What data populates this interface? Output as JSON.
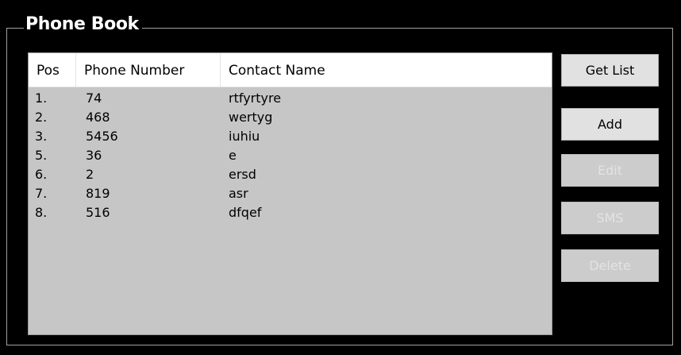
{
  "phonebook": {
    "title": "Phone Book",
    "columns": {
      "pos": "Pos",
      "phone": "Phone Number",
      "name": "Contact Name"
    },
    "rows": [
      {
        "pos": "1.",
        "phone": "74",
        "name": "rtfyrtyre"
      },
      {
        "pos": "2.",
        "phone": "468",
        "name": "wertyg"
      },
      {
        "pos": "3.",
        "phone": "5456",
        "name": "iuhiu"
      },
      {
        "pos": "5.",
        "phone": "36",
        "name": "e"
      },
      {
        "pos": "6.",
        "phone": "2",
        "name": "ersd"
      },
      {
        "pos": "7.",
        "phone": "819",
        "name": "asr"
      },
      {
        "pos": "8.",
        "phone": "516",
        "name": "dfqef"
      }
    ]
  },
  "buttons": {
    "get_list": "Get List",
    "add": "Add",
    "edit": "Edit",
    "sms": "SMS",
    "delete": "Delete"
  },
  "colors": {
    "background": "#000000",
    "list_background": "#c6c6c6",
    "header_background": "#ffffff",
    "button_background": "#e1e1e1",
    "button_disabled_text": "#e3e3e3"
  }
}
